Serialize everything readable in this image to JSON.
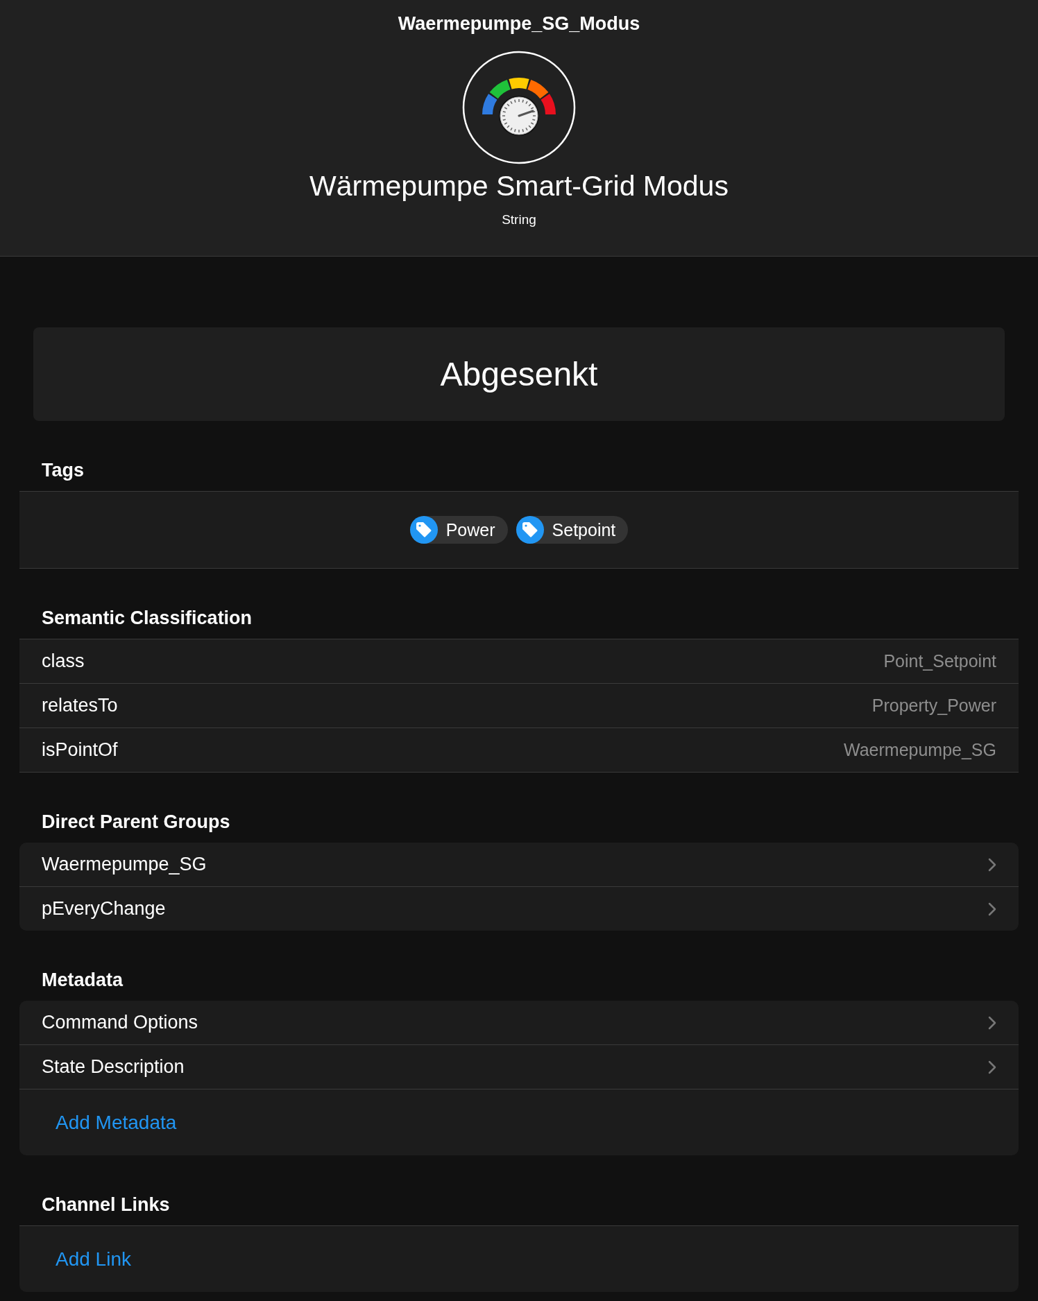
{
  "header": {
    "name": "Waermepumpe_SG_Modus",
    "label": "Wärmepumpe Smart-Grid Modus",
    "type": "String"
  },
  "state": "Abgesenkt",
  "sections": [
    {
      "kind": "tags",
      "title": "Tags",
      "tags": [
        "Power",
        "Setpoint"
      ]
    },
    {
      "kind": "properties",
      "title": "Semantic Classification",
      "rows": [
        {
          "label": "class",
          "value": "Point_Setpoint"
        },
        {
          "label": "relatesTo",
          "value": "Property_Power"
        },
        {
          "label": "isPointOf",
          "value": "Waermepumpe_SG"
        }
      ]
    },
    {
      "kind": "navigation",
      "title": "Direct Parent Groups",
      "rows": [
        {
          "label": "Waermepumpe_SG"
        },
        {
          "label": "pEveryChange"
        }
      ]
    },
    {
      "kind": "navigation",
      "title": "Metadata",
      "rows": [
        {
          "label": "Command Options"
        },
        {
          "label": "State Description"
        }
      ],
      "action": "Add Metadata"
    },
    {
      "kind": "actions",
      "title": "Channel Links",
      "action": "Add Link"
    }
  ]
}
